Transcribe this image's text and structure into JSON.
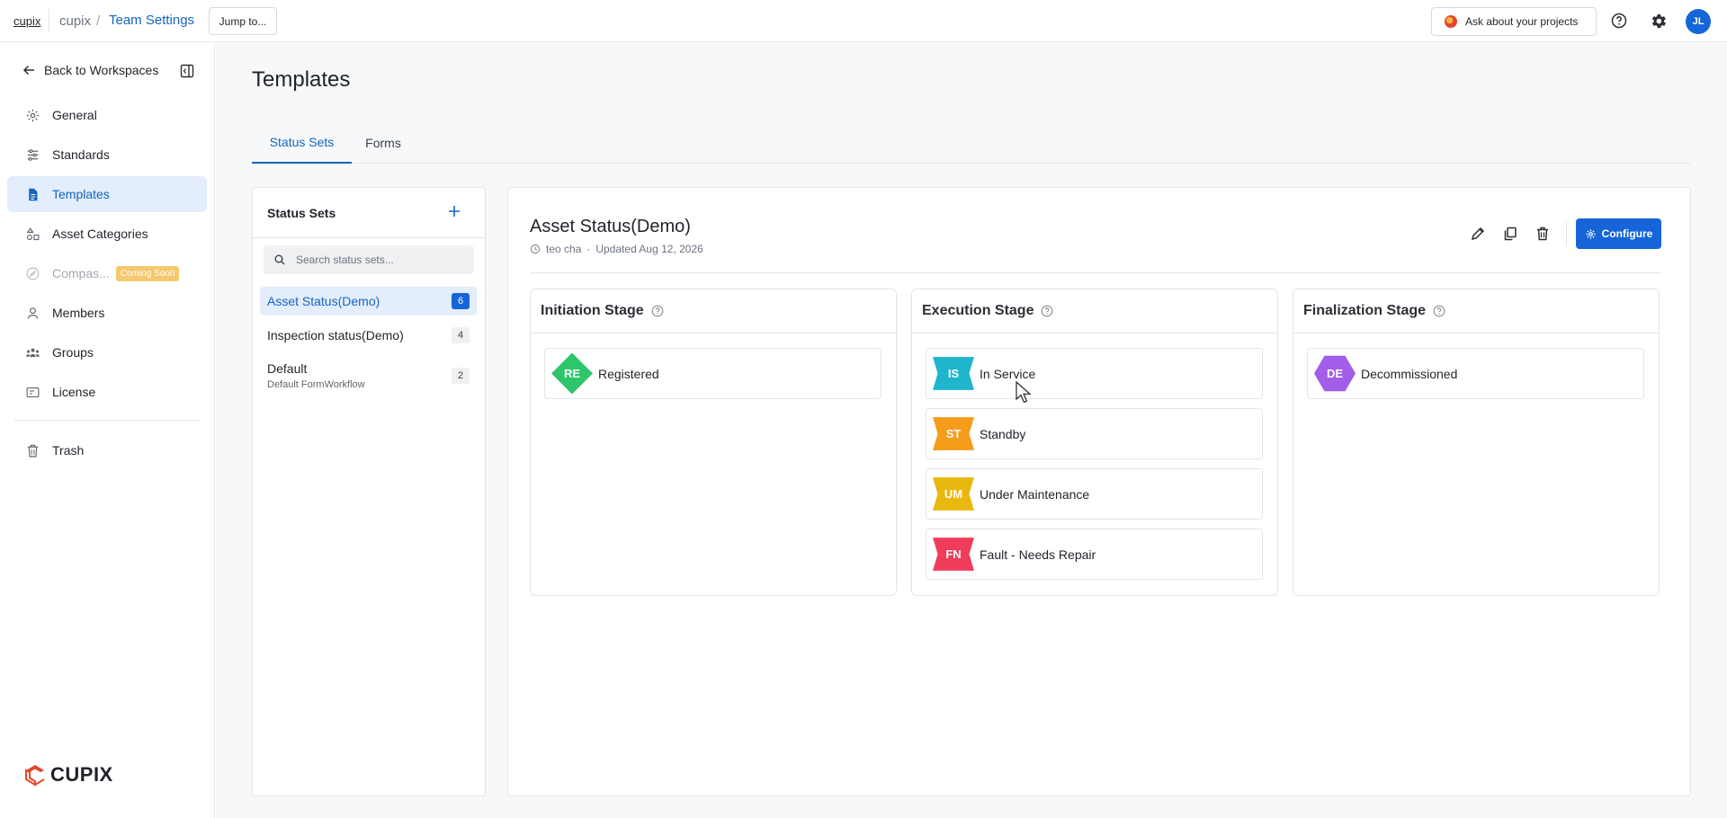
{
  "topbar": {
    "brand_link": "cupix",
    "team": "cupix",
    "slash": "/",
    "current": "Team Settings",
    "jump_button": "Jump to...",
    "ask_button": "Ask about your projects",
    "avatar_initials": "JL"
  },
  "sidebar": {
    "back_label": "Back to Workspaces",
    "items": [
      {
        "label": "General",
        "icon": "gear-icon"
      },
      {
        "label": "Standards",
        "icon": "sliders-icon"
      },
      {
        "label": "Templates",
        "icon": "document-icon",
        "active": true
      },
      {
        "label": "Asset Categories",
        "icon": "shapes-icon"
      },
      {
        "label": "Compas...",
        "icon": "compass-icon",
        "disabled": true,
        "badge": "Coming Soon"
      },
      {
        "label": "Members",
        "icon": "user-icon"
      },
      {
        "label": "Groups",
        "icon": "group-icon"
      },
      {
        "label": "License",
        "icon": "license-icon"
      },
      {
        "label": "Trash",
        "icon": "trash-icon"
      }
    ],
    "logo_text": "CUPIX"
  },
  "main": {
    "title": "Templates",
    "tabs": [
      {
        "label": "Status Sets",
        "active": true
      },
      {
        "label": "Forms",
        "active": false
      }
    ]
  },
  "status_sets_panel": {
    "title": "Status Sets",
    "search_placeholder": "Search status sets...",
    "items": [
      {
        "name": "Asset Status(Demo)",
        "count": "6",
        "active": true
      },
      {
        "name": "Inspection status(Demo)",
        "count": "4"
      },
      {
        "name": "Default",
        "subtitle": "Default FormWorkflow",
        "count": "2"
      }
    ]
  },
  "detail": {
    "title": "Asset Status(Demo)",
    "author": "teo cha",
    "dot": "·",
    "updated": "Updated Aug 12, 2026",
    "configure_label": "Configure",
    "stages": [
      {
        "title": "Initiation Stage",
        "statuses": [
          {
            "code": "RE",
            "label": "Registered",
            "color": "#2ec66b",
            "shape": "diamond"
          }
        ]
      },
      {
        "title": "Execution Stage",
        "statuses": [
          {
            "code": "IS",
            "label": "In Service",
            "color": "#1fb5cc",
            "shape": "ribbon"
          },
          {
            "code": "ST",
            "label": "Standby",
            "color": "#f59c1a",
            "shape": "ribbon"
          },
          {
            "code": "UM",
            "label": "Under Maintenance",
            "color": "#e8b80f",
            "shape": "ribbon"
          },
          {
            "code": "FN",
            "label": "Fault - Needs Repair",
            "color": "#ef3c5a",
            "shape": "ribbon"
          }
        ]
      },
      {
        "title": "Finalization Stage",
        "statuses": [
          {
            "code": "DE",
            "label": "Decommissioned",
            "color": "#a25ee8",
            "shape": "hexagon"
          }
        ]
      }
    ]
  }
}
